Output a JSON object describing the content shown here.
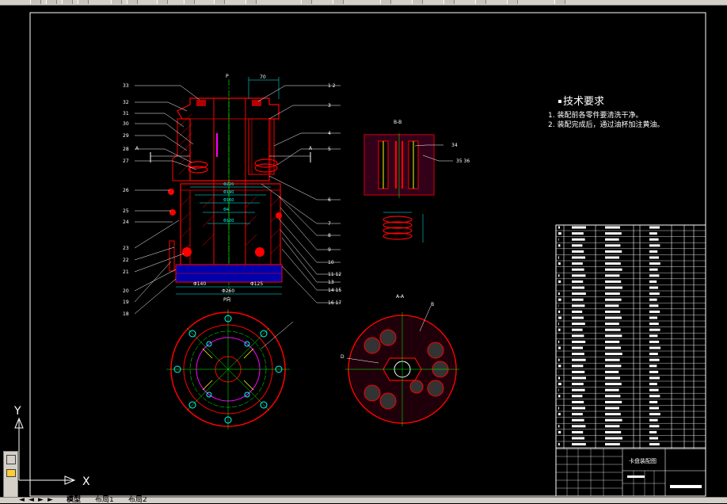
{
  "tech_requirements": {
    "title": "技术要求",
    "items": [
      "1. 装配前各零件要清洗干净。",
      "2. 装配完成后，通过油杯加注黄油。"
    ]
  },
  "section_labels": {
    "bb": "B-B",
    "aa": "A-A",
    "p_top": "P",
    "p_bottom": "P向",
    "a_left": "A",
    "a_right": "A",
    "b_mark": "B",
    "d_mark": "D"
  },
  "part_numbers_left": [
    "33",
    "32",
    "31",
    "30",
    "29",
    "28",
    "27",
    "26",
    "25",
    "24",
    "23",
    "22",
    "21",
    "20",
    "19",
    "18"
  ],
  "part_numbers_right": [
    "1 2",
    "3",
    "4",
    "5",
    "6",
    "7",
    "8",
    "9",
    "10",
    "11 12",
    "13",
    "14 15",
    "16 17"
  ],
  "part_numbers_bb": [
    "34",
    "35 36"
  ],
  "dimensions": {
    "top_width": "70",
    "left_half": "Φ140",
    "right_half": "Φ125",
    "overall": "Φ260"
  },
  "title_block": {
    "drawing_name": "卡盘装配图"
  },
  "ucs": {
    "x": "X",
    "y": "Y"
  },
  "layout_tabs": [
    "模型",
    "布局1",
    "布局2"
  ],
  "colors": {
    "background": "#000000",
    "outline": "#ff0000",
    "center": "#00ff00",
    "dim": "#ff00ff",
    "hatch": "#00ffff",
    "text": "#ffffff",
    "ui": "#d4d0c8"
  }
}
